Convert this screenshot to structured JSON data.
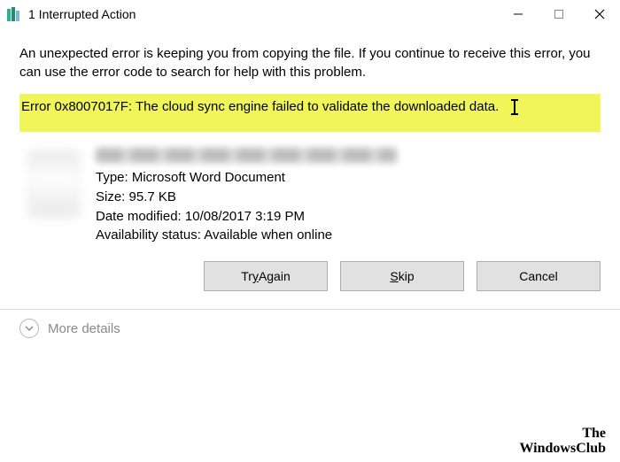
{
  "titlebar": {
    "title": "1 Interrupted Action"
  },
  "body": {
    "description": "An unexpected error is keeping you from copying the file. If you continue to receive this error, you can use the error code to search for help with this problem.",
    "error_message": "Error 0x8007017F: The cloud sync engine failed to validate the downloaded data."
  },
  "file": {
    "type_label": "Type:",
    "type_value": "Microsoft Word Document",
    "size_label": "Size:",
    "size_value": "95.7 KB",
    "modified_label": "Date modified:",
    "modified_value": "10/08/2017 3:19 PM",
    "availability_label": "Availability status:",
    "availability_value": "Available when online"
  },
  "buttons": {
    "try_again_pre": "Tr",
    "try_again_u": "y",
    "try_again_post": " Again",
    "skip_u": "S",
    "skip_post": "kip",
    "cancel": "Cancel"
  },
  "footer": {
    "more_details": "More details"
  },
  "watermark": {
    "line1": "The",
    "line2": "WindowsClub"
  }
}
